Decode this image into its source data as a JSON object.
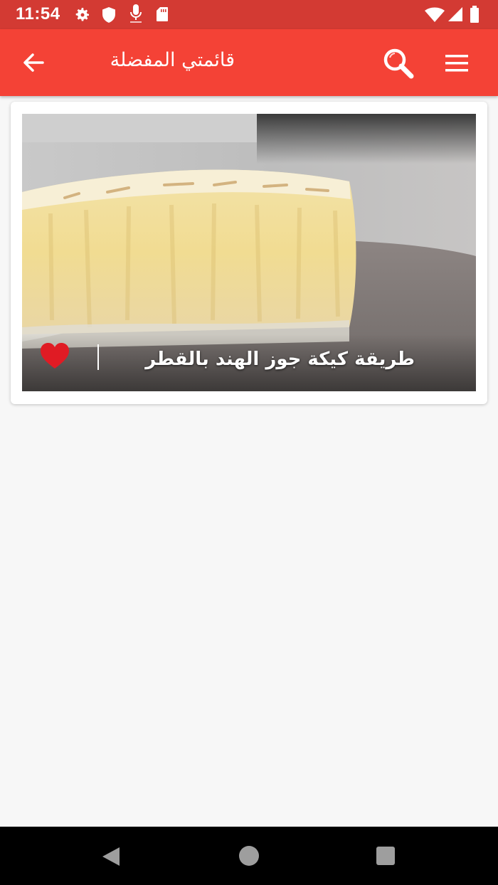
{
  "status_bar": {
    "time": "11:54",
    "icons": [
      "gear-icon",
      "shield-icon",
      "mic-icon",
      "sd-card-icon",
      "wifi-icon",
      "signal-icon",
      "battery-icon"
    ]
  },
  "app_bar": {
    "title": "قائمتي المفضلة",
    "back_icon": "arrow-back-icon",
    "search_icon": "search-icon",
    "menu_icon": "menu-icon",
    "color": "#f44236"
  },
  "favorites": [
    {
      "title": "طريقة كيكة جوز الهند بالقطر",
      "favorite": true,
      "heart_color": "#e01b24"
    }
  ],
  "nav_bar": {
    "icons": [
      "nav-back-icon",
      "nav-home-icon",
      "nav-recents-icon"
    ]
  }
}
